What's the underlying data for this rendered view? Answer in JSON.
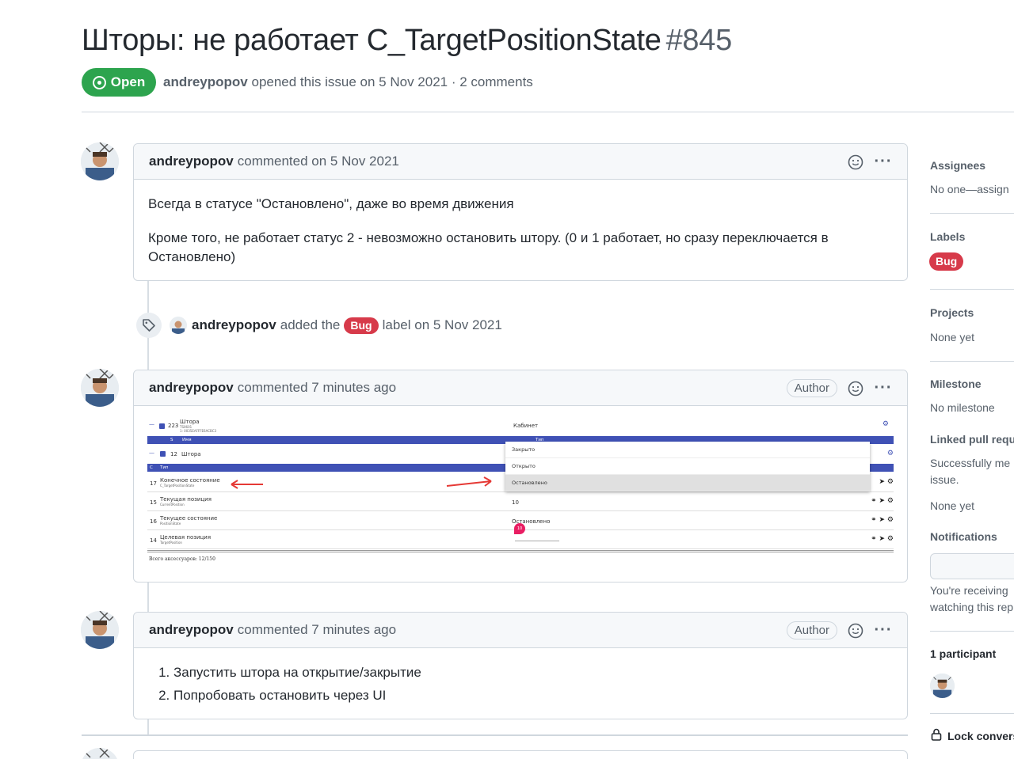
{
  "issue": {
    "title": "Шторы: не работает C_TargetPositionState",
    "number": "#845",
    "state": "Open",
    "author": "andreypopov",
    "meta_text": "opened this issue on 5 Nov 2021 · 2 comments"
  },
  "comments": [
    {
      "author": "andreypopov",
      "action": "commented on 5 Nov 2021",
      "badge": "",
      "paragraphs": [
        "Всегда в статусе \"Остановлено\", даже во время движения",
        "Кроме того, не работает статус 2 - невозможно остановить штору. (0 и 1 работает, но сразу переключается в Остановлено)"
      ]
    },
    {
      "author": "andreypopov",
      "action": "commented 7 minutes ago",
      "badge": "Author"
    },
    {
      "author": "andreypopov",
      "action": "commented 7 minutes ago",
      "badge": "Author",
      "list": [
        "Запустить штора на открытие/закрытие",
        "Попробовать остановить через UI"
      ]
    }
  ],
  "event": {
    "author": "andreypopov",
    "text_before": "added the",
    "label": "Bug",
    "text_after": "label on 5 Nov 2021"
  },
  "screenshot": {
    "top_row": {
      "num": "223",
      "name": "Штора",
      "sub1": "TS0601",
      "sub2": "1: 0035EAFFFE6ACBC3",
      "room": "Кабинет"
    },
    "header_bar": {
      "s": "S",
      "name": "Имя",
      "type": "Тип"
    },
    "group_row": {
      "num": "12",
      "name": "Штора"
    },
    "group_bar": {
      "c": "C",
      "type": "Тип"
    },
    "rows": [
      {
        "num": "17",
        "name": "Конечное состояние",
        "sub": "C_TargetPositionState",
        "value": ""
      },
      {
        "num": "15",
        "name": "Текущая позиция",
        "sub": "CurrentPosition",
        "value": "10"
      },
      {
        "num": "16",
        "name": "Текущее состояние",
        "sub": "PositionState",
        "value": "Остановлено"
      },
      {
        "num": "14",
        "name": "Целевая позиция",
        "sub": "TargetPosition",
        "value": ""
      }
    ],
    "slider_value": "10",
    "dropdown": [
      "Закрыто",
      "Открыто",
      "Остановлено"
    ],
    "dropdown_selected": "Остановлено",
    "footer": "Всего аксессуаров: 12/150"
  },
  "sidebar": {
    "assignees_title": "Assignees",
    "assignees_value": "No one—assign",
    "labels_title": "Labels",
    "labels_value": "Bug",
    "projects_title": "Projects",
    "projects_value": "None yet",
    "milestone_title": "Milestone",
    "milestone_value": "No milestone",
    "linked_title": "Linked pull requ",
    "linked_line1": "Successfully me",
    "linked_line2": "issue.",
    "linked_value": "None yet",
    "notifications_title": "Notifications",
    "notifications_line1": "You're receiving",
    "notifications_line2": "watching this rep",
    "participants_title": "1 participant",
    "lock_label": "Lock convers"
  },
  "colors": {
    "open_green": "#2da44e",
    "bug_red": "#d73a4a",
    "ui_indigo": "#3f51b5"
  }
}
